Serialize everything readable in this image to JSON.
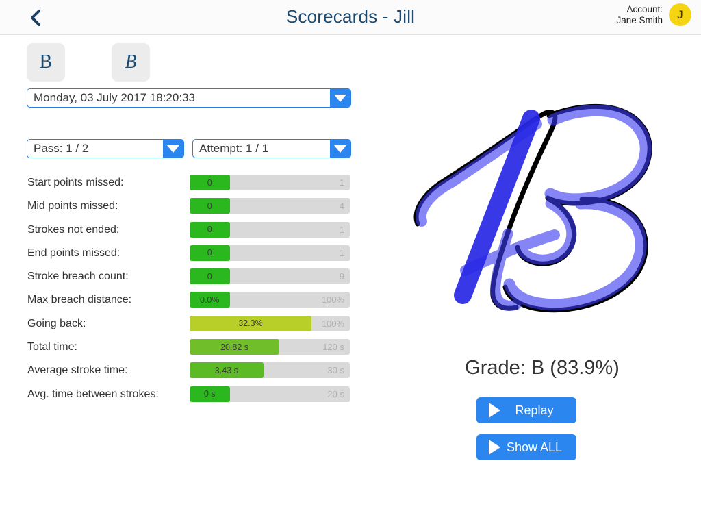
{
  "header": {
    "back_icon": "chevron-left-icon",
    "title": "Scorecards - Jill",
    "account_label": "Account:",
    "account_name": "Jane Smith",
    "avatar_initial": "J",
    "avatar_color": "#f5d412",
    "title_color": "#1b4a72"
  },
  "letter_tabs": [
    {
      "label": "B",
      "style": "upright"
    },
    {
      "label": "B",
      "style": "italic"
    }
  ],
  "selects": {
    "date": {
      "value": "Monday, 03 July 2017 18:20:33",
      "arrow_icon": "chevron-down-icon"
    },
    "pass": {
      "value": "Pass: 1 / 2",
      "arrow_icon": "chevron-down-icon"
    },
    "attempt": {
      "value": "Attempt: 1 / 1",
      "arrow_icon": "chevron-down-icon"
    }
  },
  "chart_data": {
    "type": "bar",
    "title": "",
    "xlabel": "",
    "ylabel": "",
    "grid": false,
    "legend": false,
    "orientation": "horizontal",
    "categories": [
      "Start points missed:",
      "Mid points missed:",
      "Strokes not ended:",
      "End points missed:",
      "Stroke breach count:",
      "Max breach distance:",
      "Going back:",
      "Total time:",
      "Average stroke time:",
      "Avg. time between strokes:"
    ],
    "values": [
      0,
      0,
      0,
      0,
      0,
      0.0,
      32.3,
      20.82,
      3.43,
      0
    ],
    "value_labels": [
      "0",
      "0",
      "0",
      "0",
      "0",
      "0.0%",
      "32.3%",
      "20.82 s",
      "3.43 s",
      "0 s"
    ],
    "max_labels": [
      "1",
      "4",
      "1",
      "1",
      "9",
      "100%",
      "100%",
      "120 s",
      "30 s",
      "20 s"
    ],
    "maximums": [
      1,
      4,
      1,
      1,
      9,
      100,
      100,
      120,
      30,
      20
    ],
    "fill_percents": [
      25,
      25,
      25,
      25,
      25,
      25,
      76,
      56,
      46,
      25
    ],
    "fill_colors": [
      "#2ab81e",
      "#2ab81e",
      "#2ab81e",
      "#2ab81e",
      "#2ab81e",
      "#2ab81e",
      "#b8cf29",
      "#6fbe2a",
      "#5cbb24",
      "#2ab81e"
    ],
    "track_color": "#d9d9d9"
  },
  "result": {
    "grade_text": "Grade: B (83.9%)",
    "replay_label": "Replay",
    "showall_label": "Show ALL",
    "play_icon": "play-triangle-icon",
    "button_color": "#2b86ef"
  },
  "drawing": {
    "name": "cursive-letter-b-tracing",
    "outline_color": "#000000",
    "stroke_color": "#3b3bf0"
  }
}
